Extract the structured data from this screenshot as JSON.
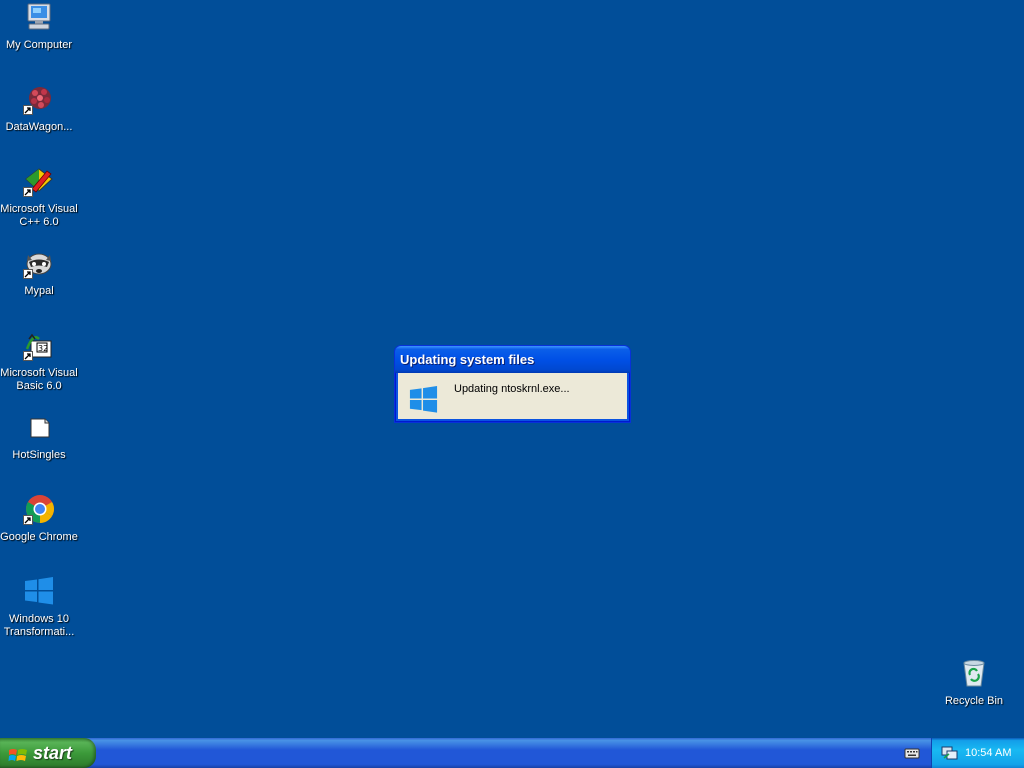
{
  "desktop": {
    "background": "#014e99",
    "icons": [
      {
        "label": "My Computer",
        "icon": "computer-icon",
        "shortcut": false
      },
      {
        "label": "DataWagon...",
        "icon": "datawagon-icon",
        "shortcut": true
      },
      {
        "label": "Microsoft Visual C++ 6.0",
        "icon": "visual-cpp-icon",
        "shortcut": true
      },
      {
        "label": "Mypal",
        "icon": "raccoon-icon",
        "shortcut": true
      },
      {
        "label": "Microsoft Visual Basic 6.0",
        "icon": "visual-basic-icon",
        "shortcut": true
      },
      {
        "label": "HotSingles",
        "icon": "document-icon",
        "shortcut": false
      },
      {
        "label": "Google Chrome",
        "icon": "chrome-icon",
        "shortcut": true
      },
      {
        "label": "Windows 10 Transformati...",
        "icon": "windows-logo-icon",
        "shortcut": false
      },
      {
        "label": "Recycle Bin",
        "icon": "recycle-bin-icon",
        "shortcut": false
      }
    ]
  },
  "dialog": {
    "title": "Updating system files",
    "message": "Updating ntoskrnl.exe...",
    "icon": "windows-logo-icon"
  },
  "taskbar": {
    "start_label": "start",
    "tray": {
      "keyboard_icon": "keyboard-icon",
      "network_icon": "network-icon",
      "clock": "10:54 AM"
    }
  },
  "colors": {
    "desktop": "#014e99",
    "taskbar_blue": "#2157d7",
    "start_green": "#3c9a3a",
    "tray_blue": "#18b9f2",
    "dialog_title": "#0050e6",
    "dialog_body": "#ece9d8"
  }
}
